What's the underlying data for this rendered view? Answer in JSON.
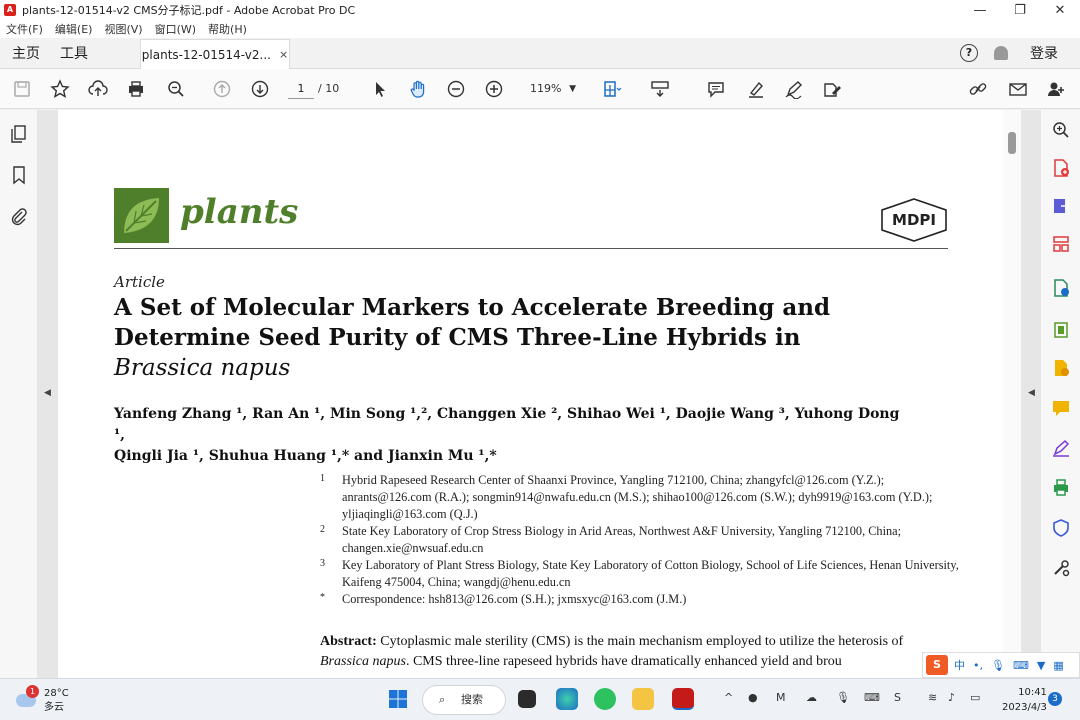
{
  "window": {
    "title": "plants-12-01514-v2  CMS分子标记.pdf - Adobe Acrobat Pro DC",
    "minimize": "—",
    "maximize": "❐",
    "close": "✕"
  },
  "menu": [
    "文件(F)",
    "编辑(E)",
    "视图(V)",
    "窗口(W)",
    "帮助(H)"
  ],
  "tabs": {
    "home": "主页",
    "tools": "工具",
    "doc": "plants-12-01514-v2...",
    "close": "×",
    "help": "?",
    "login": "登录"
  },
  "toolbar": {
    "page_current": "1",
    "page_total": "/ 10",
    "zoom": "119%"
  },
  "document": {
    "journal": "plants",
    "publisher": "MDPI",
    "article_type": "Article",
    "title_line1": "A Set of Molecular Markers to Accelerate Breeding and",
    "title_line2": "Determine Seed Purity of CMS Three-Line Hybrids in",
    "title_line3": "Brassica napus",
    "authors_line1": "Yanfeng Zhang ¹, Ran An ¹, Min Song ¹,², Changgen Xie ², Shihao Wei ¹, Daojie Wang ³, Yuhong Dong ¹,",
    "authors_line2": "Qingli Jia ¹, Shuhua Huang ¹,* and Jianxin Mu ¹,*",
    "affiliations": [
      {
        "num": "1",
        "text": "Hybrid Rapeseed Research Center of Shaanxi Province, Yangling 712100, China; zhangyfcl@126.com (Y.Z.); anrants@126.com (R.A.); songmin914@nwafu.edu.cn (M.S.); shihao100@126.com (S.W.); dyh9919@163.com (Y.D.); yljiaqingli@163.com (Q.J.)"
      },
      {
        "num": "2",
        "text": "State Key Laboratory of Crop Stress Biology in Arid Areas, Northwest A&F University, Yangling 712100, China; changen.xie@nwsuaf.edu.cn"
      },
      {
        "num": "3",
        "text": "Key Laboratory of Plant Stress Biology, State Key Laboratory of Cotton Biology, School of Life Sciences, Henan University, Kaifeng 475004, China; wangdj@henu.edu.cn"
      },
      {
        "num": "*",
        "text": "Correspondence: hsh813@126.com (S.H.); jxmsxyc@163.com (J.M.)"
      }
    ],
    "abstract_label": "Abstract:",
    "abstract_text1": " Cytoplasmic male sterility (CMS) is the main mechanism employed to utilize the heterosis of ",
    "abstract_species": "Brassica napus",
    "abstract_text2": ". CMS three-line rapeseed hybrids have dramatically enhanced yield and brou"
  },
  "taskbar": {
    "weather_badge": "1",
    "temperature": "28°C",
    "condition": "多云",
    "search": "搜索",
    "time": "10:41",
    "date": "2023/4/3",
    "notifications": "3"
  },
  "ime": {
    "logo": "S",
    "lang": "中"
  },
  "colors": {
    "journal_green": "#4f7f2b",
    "acrobat_red": "#d8221a",
    "accent_blue": "#1b6cc9",
    "sidebar_red": "#e03a3a"
  }
}
